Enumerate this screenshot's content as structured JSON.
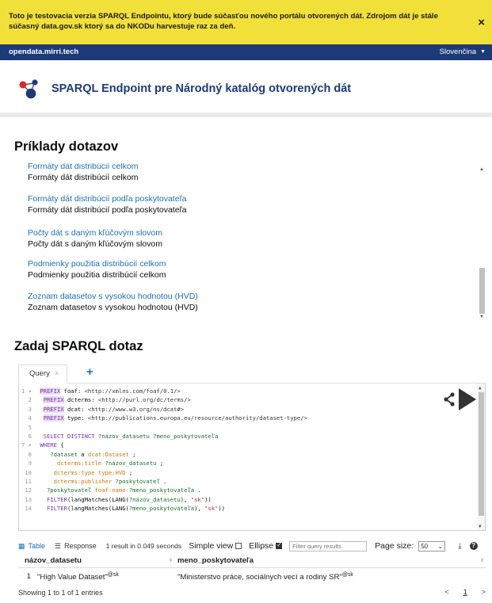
{
  "banner": {
    "text": "Toto je testovacia verzia SPARQL Endpointu, ktorý bude súčasťou nového portálu otvorených dát. Zdrojom dát je stále súčasný data.gov.sk ktorý sa do NKODu harvestuje raz za deň.",
    "close": "×"
  },
  "nav": {
    "host": "opendata.mirri.tech",
    "language": "Slovenčina",
    "caret": "▼"
  },
  "header": {
    "title": "SPARQL Endpoint pre Národný katalóg otvorených dát"
  },
  "examples": {
    "heading": "Príklady dotazov",
    "items": [
      {
        "link": "Formáty dát distribúcií celkom",
        "desc": "Formáty dát distribúcií celkom"
      },
      {
        "link": "Formáty dát distribúcií podľa poskytovateľa",
        "desc": "Formáty dát distribúcií podľa poskytovateľa"
      },
      {
        "link": "Počty dát s daným kľúčovým slovom",
        "desc": "Počty dát s daným kľúčovým slovom"
      },
      {
        "link": "Podmienky použitia distribúcií celkom",
        "desc": "Podmienky použitia distribúcií celkom"
      },
      {
        "link": "Zoznam datasetov s vysokou hodnotou (HVD)",
        "desc": "Zoznam datasetov s vysokou hodnotou (HVD)"
      }
    ]
  },
  "query": {
    "heading": "Zadaj SPARQL dotaz",
    "tab_label": "Query",
    "tab_close": "×",
    "add_tab": "+",
    "lines": [
      "1 ▾ PREFIX foaf: <http://xmlns.com/foaf/0.1/>",
      "2   PREFIX dcterms: <http://purl.org/dc/terms/>",
      "3   PREFIX dcat: <http://www.w3.org/ns/dcat#>",
      "4   PREFIX type: <http://publications.europa.eu/resource/authority/dataset-type/>",
      "5",
      "6   SELECT DISTINCT ?názov_datasetu ?meno_poskytovateľa",
      "7 ▾ WHERE {",
      "8     ?dataset a dcat:Dataset ;",
      "9       dcterms:title ?názov_datasetu ;",
      "10      dcterms:type type:HVD ;",
      "11      dcterms:publisher ?poskytovateľ .",
      "12    ?poskytovateľ foaf:name ?meno_poskytovateľa .",
      "13    FILTER(langMatches(LANG(?názov_datasetu), \"sk\"))",
      "14    FILTER(langMatches(LANG(?meno_poskytovateľa), \"sk\"))"
    ]
  },
  "results": {
    "tab_table": "Table",
    "tab_response": "Response",
    "info": "1 result in 0.049 seconds",
    "simple_view": "Simple view",
    "ellipse": "Ellipse",
    "filter_placeholder": "Filter query results",
    "page_size_label": "Page size:",
    "page_size_value": "50",
    "columns": [
      "názov_datasetu",
      "meno_poskytovateľa"
    ],
    "rows": [
      {
        "num": "1",
        "c1": "\"High Value Dataset\"",
        "c1_lang": "@sk",
        "c2": "\"Ministerstvo práce, sociálnych vecí a rodiny SR\"",
        "c2_lang": "@sk"
      }
    ],
    "showing": "Showing 1 to 1 of 1 entries",
    "prev": "<",
    "page": "1",
    "next": ">"
  }
}
